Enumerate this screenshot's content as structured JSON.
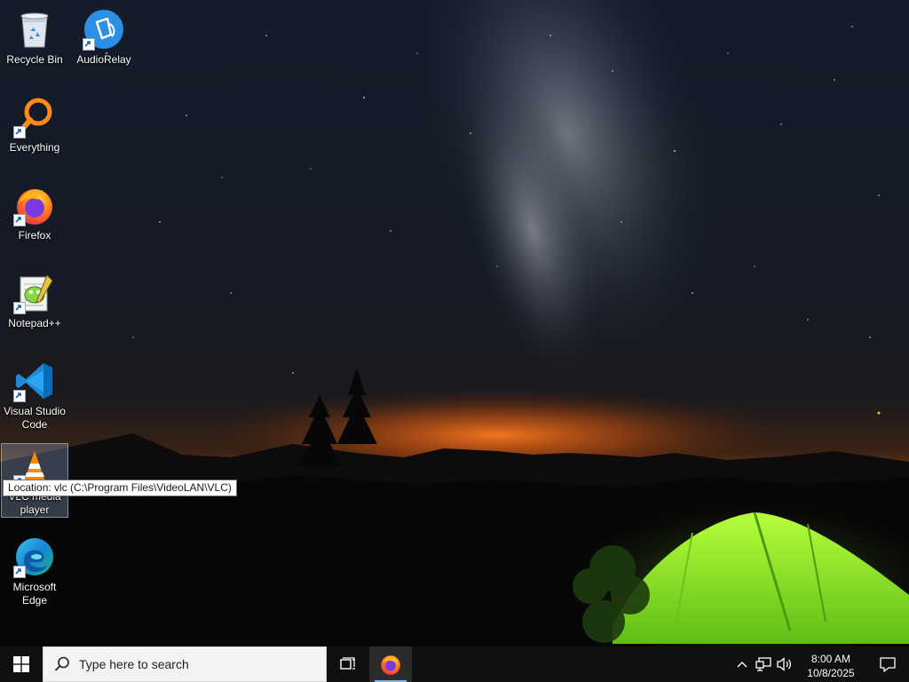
{
  "desktop": {
    "icons": [
      {
        "label": "Recycle Bin",
        "icon": "recycle-bin-icon"
      },
      {
        "label": "AudioRelay",
        "icon": "audiorelay-icon"
      },
      {
        "label": "Everything",
        "icon": "everything-icon"
      },
      {
        "label": "Firefox",
        "icon": "firefox-icon"
      },
      {
        "label": "Notepad++",
        "icon": "notepadpp-icon"
      },
      {
        "label": "Visual Studio Code",
        "icon": "vscode-icon"
      },
      {
        "label": "VLC media player",
        "icon": "vlc-icon"
      },
      {
        "label": "Microsoft Edge",
        "icon": "edge-icon"
      }
    ],
    "tooltip": "Location: vlc (C:\\Program Files\\VideoLAN\\VLC)",
    "selected_icon": "VLC media player"
  },
  "taskbar": {
    "search_placeholder": "Type here to search",
    "pinned_apps": [
      "Firefox"
    ],
    "clock": {
      "time": "8:00 AM",
      "date": "10/8/2025"
    },
    "tray_icons": [
      "chevron-up-icon",
      "network-icon",
      "volume-icon"
    ]
  },
  "colors": {
    "taskbar_bg": "#101010",
    "search_bg": "#f3f3f3",
    "selection": "#96afd2",
    "active_indicator": "#7cb7f0"
  }
}
